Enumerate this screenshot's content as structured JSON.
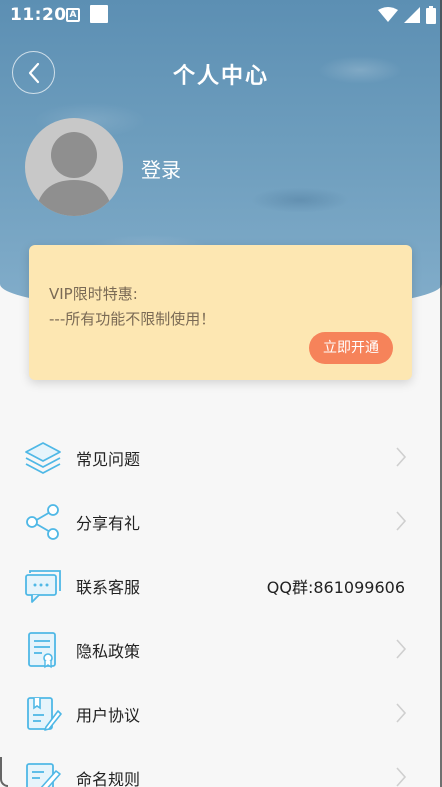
{
  "status_bar": {
    "time": "11:20",
    "a_badge": "A"
  },
  "header": {
    "title": "个人中心"
  },
  "profile": {
    "login_label": "登录"
  },
  "vip": {
    "line1": "VIP限时特惠:",
    "line2": "---所有功能不限制使用！",
    "cta": "立即开通"
  },
  "menu": [
    {
      "label": "常见问题",
      "icon": "layers-icon"
    },
    {
      "label": "分享有礼",
      "icon": "share-icon"
    },
    {
      "label": "联系客服",
      "icon": "chat-icon",
      "value": "QQ群:861099606"
    },
    {
      "label": "隐私政策",
      "icon": "document-icon"
    },
    {
      "label": "用户协议",
      "icon": "agreement-icon"
    },
    {
      "label": "命名规则",
      "icon": "edit-icon"
    }
  ],
  "colors": {
    "accent": "#4fb8e6",
    "vip_bg": "#fde7b2",
    "vip_button": "#f6835a"
  }
}
